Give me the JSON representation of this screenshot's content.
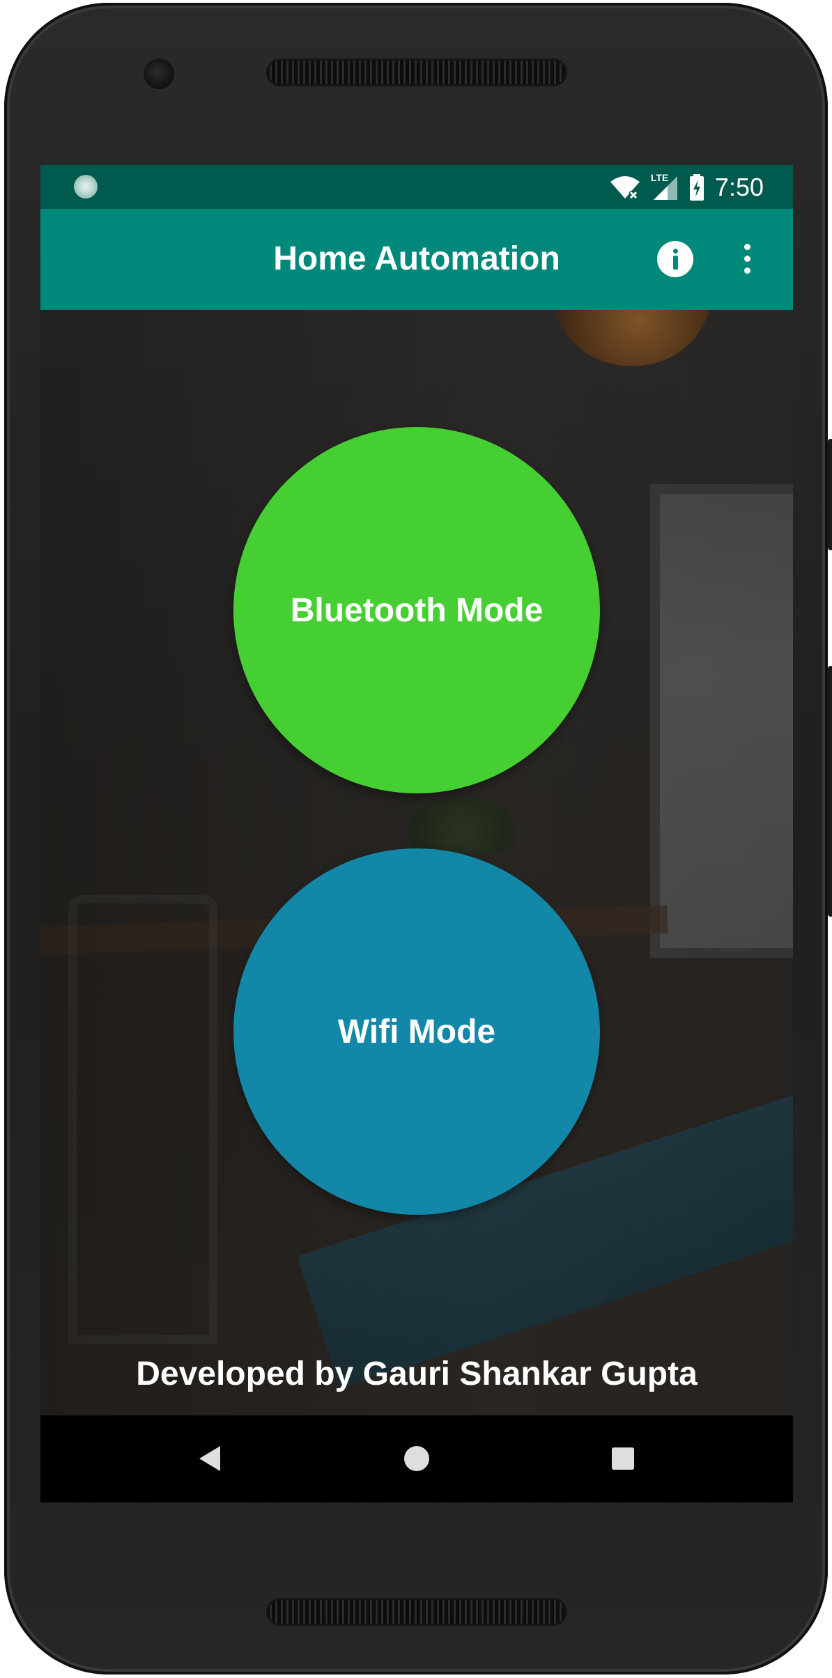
{
  "status_bar": {
    "time": "7:50",
    "network_label": "LTE",
    "icons": [
      "sync-icon",
      "wifi-off-icon",
      "cell-signal-icon",
      "battery-charging-icon"
    ]
  },
  "app_bar": {
    "title": "Home Automation",
    "actions": [
      "info-icon",
      "more-vert-icon"
    ],
    "color": "#00897b"
  },
  "main": {
    "bluetooth_button": {
      "label": "Bluetooth Mode",
      "color": "#46cf32"
    },
    "wifi_button": {
      "label": "Wifi Mode",
      "color": "#1287a8"
    },
    "credit": "Developed by Gauri Shankar Gupta"
  },
  "nav_bar": {
    "items": [
      "back-icon",
      "home-icon",
      "recents-icon"
    ]
  }
}
